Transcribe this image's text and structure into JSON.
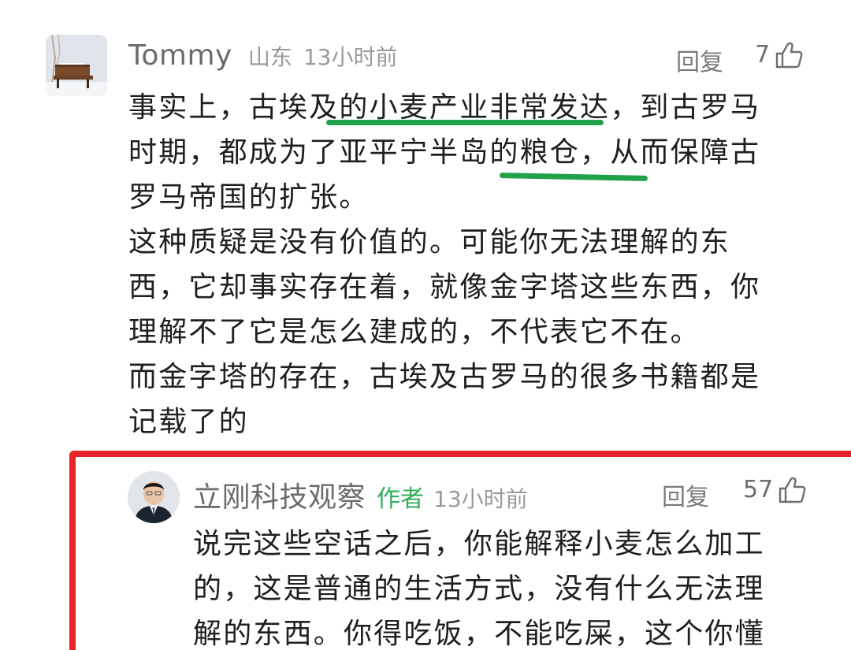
{
  "comments": [
    {
      "username": "Tommy",
      "location": "山东",
      "time": "13小时前",
      "reply_label": "回复",
      "like_count": "7",
      "lines": [
        "事实上，古埃及的小麦产业非常发达，到古罗马",
        "时期，都成为了亚平宁半岛的粮仓，从而保障古",
        "罗马帝国的扩张。",
        "这种质疑是没有价值的。可能你无法理解的东",
        "西，它却事实存在着，就像金字塔这些东西，你",
        "理解不了它是怎么建成的，不代表它不在。",
        "而金字塔的存在，古埃及古罗马的很多书籍都是",
        "记载了的"
      ]
    },
    {
      "username": "立刚科技观察",
      "badge": "作者",
      "time": "13小时前",
      "reply_label": "回复",
      "like_count": "57",
      "lines": [
        "说完这些空话之后，你能解释小麦怎么加工",
        "的，这是普通的生活方式，没有什么无法理",
        "解的东西。你得吃饭，不能吃屎，这个你懂"
      ]
    }
  ],
  "colors": {
    "underline": "#21a14a",
    "highlight_border": "#e8232a",
    "author_badge": "#2fae5a"
  },
  "icons": {
    "like": "thumbs-up-icon"
  }
}
